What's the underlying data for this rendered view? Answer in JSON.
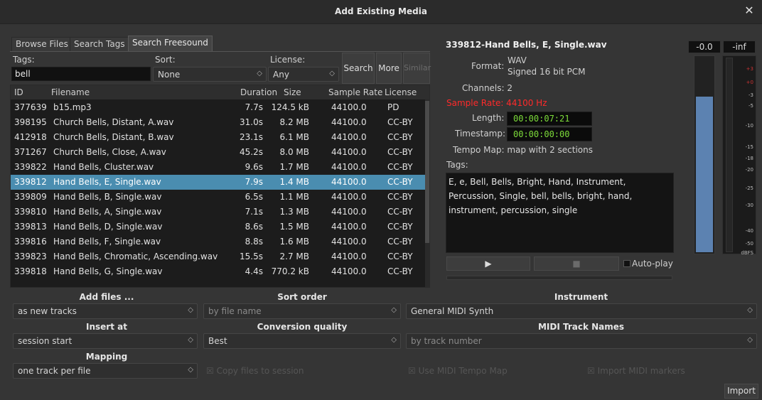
{
  "window": {
    "title": "Add Existing Media",
    "close_label": "✕"
  },
  "tabs": [
    "Browse Files",
    "Search Tags",
    "Search Freesound"
  ],
  "search": {
    "tags_label": "Tags:",
    "tags_value": "bell",
    "sort_label": "Sort:",
    "sort_value": "None",
    "license_label": "License:",
    "license_value": "Any",
    "search_btn": "Search",
    "more_btn": "More",
    "similar_btn": "Similar"
  },
  "table": {
    "headers": [
      "ID",
      "Filename",
      "Duration",
      "Size",
      "Sample Rate",
      "License"
    ],
    "rows": [
      {
        "id": "377639",
        "name": "b15.mp3",
        "dur": "7.7s",
        "size": "124.5 kB",
        "rate": "44100.0",
        "lic": "PD"
      },
      {
        "id": "398195",
        "name": "Church Bells, Distant, A.wav",
        "dur": "31.0s",
        "size": "8.2 MB",
        "rate": "44100.0",
        "lic": "CC-BY"
      },
      {
        "id": "412918",
        "name": "Church Bells, Distant, B.wav",
        "dur": "23.1s",
        "size": "6.1 MB",
        "rate": "44100.0",
        "lic": "CC-BY"
      },
      {
        "id": "371267",
        "name": "Church Bells, Close, A.wav",
        "dur": "45.2s",
        "size": "8.0 MB",
        "rate": "44100.0",
        "lic": "CC-BY"
      },
      {
        "id": "339822",
        "name": "Hand Bells, Cluster.wav",
        "dur": "9.6s",
        "size": "1.7 MB",
        "rate": "44100.0",
        "lic": "CC-BY"
      },
      {
        "id": "339812",
        "name": "Hand Bells, E, Single.wav",
        "dur": "7.9s",
        "size": "1.4 MB",
        "rate": "44100.0",
        "lic": "CC-BY"
      },
      {
        "id": "339809",
        "name": "Hand Bells, B, Single.wav",
        "dur": "6.5s",
        "size": "1.1 MB",
        "rate": "44100.0",
        "lic": "CC-BY"
      },
      {
        "id": "339810",
        "name": "Hand Bells, A, Single.wav",
        "dur": "7.1s",
        "size": "1.3 MB",
        "rate": "44100.0",
        "lic": "CC-BY"
      },
      {
        "id": "339813",
        "name": "Hand Bells, D, Single.wav",
        "dur": "8.6s",
        "size": "1.5 MB",
        "rate": "44100.0",
        "lic": "CC-BY"
      },
      {
        "id": "339816",
        "name": "Hand Bells, F, Single.wav",
        "dur": "8.8s",
        "size": "1.6 MB",
        "rate": "44100.0",
        "lic": "CC-BY"
      },
      {
        "id": "339823",
        "name": "Hand Bells, Chromatic, Ascending.wav",
        "dur": "15.5s",
        "size": "2.7 MB",
        "rate": "44100.0",
        "lic": "CC-BY"
      },
      {
        "id": "339818",
        "name": "Hand Bells, G, Single.wav",
        "dur": "4.4s",
        "size": "770.2 kB",
        "rate": "44100.0",
        "lic": "CC-BY"
      }
    ]
  },
  "info": {
    "title": "339812-Hand Bells, E, Single.wav",
    "format_label": "Format:",
    "format_line1": "WAV",
    "format_line2": "Signed 16 bit PCM",
    "channels": "Channels: 2",
    "sample_rate": "Sample Rate: 44100 Hz",
    "length_label": "Length:",
    "length_value": "00:00:07:21",
    "timestamp_label": "Timestamp:",
    "timestamp_value": "00:00:00:00",
    "tempo_map": "Tempo Map: map with 2 sections",
    "tags_label": "Tags:",
    "tags_text": "E, e, Bell, Bells, Bright, Hand, Instrument, Percussion, Single, bell, bells, bright, hand, instrument, percussion, single",
    "play_icon": "▶",
    "stop_icon": "■",
    "autoplay_label": "Auto-play",
    "accent_color": "#ff2a2a"
  },
  "meter": {
    "peak_left": "-0.0",
    "peak_right": "-inf",
    "level_fraction": 0.8,
    "scale": [
      "+3",
      "+0",
      "-3",
      "-5",
      "-10",
      "-15",
      "-18",
      "-20",
      "-25",
      "-30",
      "-40",
      "-50",
      "dBFS"
    ]
  },
  "options": {
    "add_files_label": "Add files ...",
    "add_files_value": "as new tracks",
    "insert_at_label": "Insert at",
    "insert_at_value": "session start",
    "mapping_label": "Mapping",
    "mapping_value": "one track per file",
    "sort_order_label": "Sort order",
    "sort_order_value": "by file name",
    "conversion_label": "Conversion quality",
    "conversion_value": "Best",
    "copy_files": "Copy files to session",
    "instrument_label": "Instrument",
    "instrument_value": "General MIDI Synth",
    "midi_names_label": "MIDI Track Names",
    "midi_names_value": "by track number",
    "use_tempo_map": "Use MIDI Tempo Map",
    "import_markers": "Import MIDI markers",
    "import_btn": "Import"
  }
}
